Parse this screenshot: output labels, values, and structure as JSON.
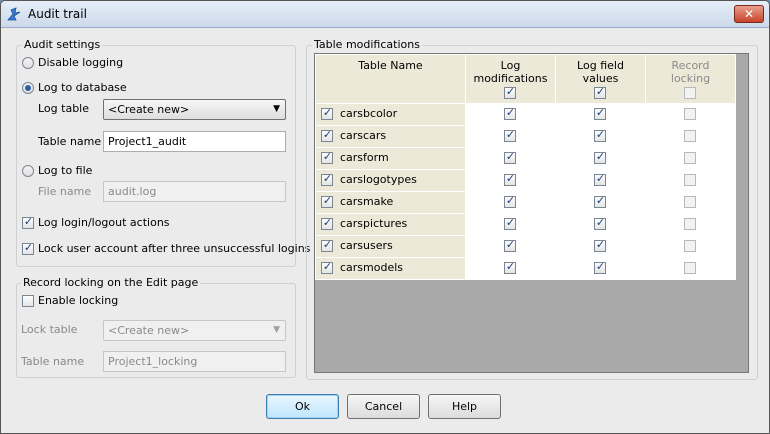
{
  "window": {
    "title": "Audit trail",
    "icon": "audit-app-icon",
    "close_label": "✕"
  },
  "audit_settings": {
    "legend": "Audit settings",
    "disable_logging": "Disable logging",
    "log_to_database": "Log to database",
    "log_table_label": "Log table",
    "log_table_value": "<Create new>",
    "table_name_label": "Table name",
    "table_name_value": "Project1_audit",
    "log_to_file": "Log to file",
    "file_name_label": "File name",
    "file_name_value": "audit.log",
    "log_login": "Log login/logout actions",
    "lock_account": "Lock user account after three unsuccessful logins"
  },
  "record_locking": {
    "legend": "Record locking on the Edit page",
    "enable_locking": "Enable locking",
    "lock_table_label": "Lock table",
    "lock_table_value": "<Create new>",
    "table_name_label": "Table name",
    "table_name_value": "Project1_locking"
  },
  "table_mods": {
    "legend": "Table modifications",
    "columns": {
      "table_name": "Table Name",
      "log_modifications": "Log modifications",
      "log_field_values": "Log field values",
      "record_locking": "Record locking"
    },
    "rows": [
      {
        "name": "carsbcolor"
      },
      {
        "name": "carscars"
      },
      {
        "name": "carsform"
      },
      {
        "name": "carslogotypes"
      },
      {
        "name": "carsmake"
      },
      {
        "name": "carspictures"
      },
      {
        "name": "carsusers"
      },
      {
        "name": "carsmodels"
      }
    ]
  },
  "buttons": {
    "ok": "Ok",
    "cancel": "Cancel",
    "help": "Help"
  }
}
